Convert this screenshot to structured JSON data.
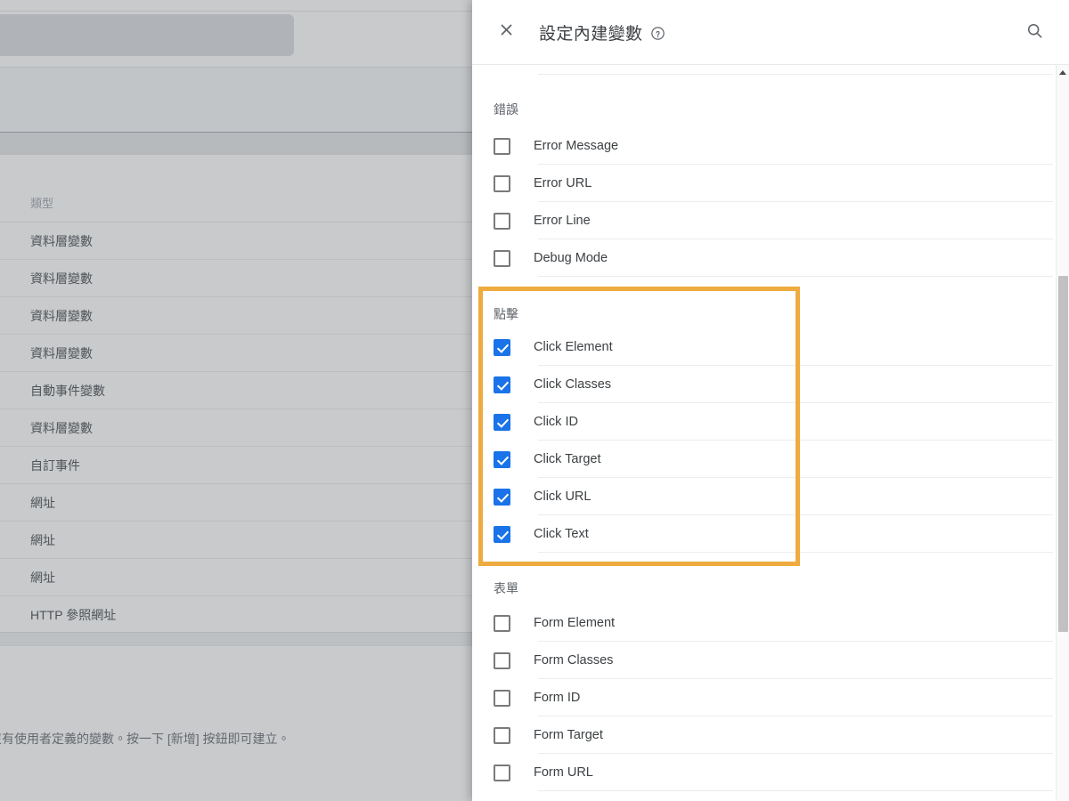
{
  "background": {
    "search_placeholder": "",
    "table": {
      "header": "類型",
      "rows": [
        "資料層變數",
        "資料層變數",
        "資料層變數",
        "資料層變數",
        "自動事件變數",
        "資料層變數",
        "自訂事件",
        "網址",
        "網址",
        "網址",
        "HTTP 參照網址"
      ]
    },
    "empty_note": "容器沒有使用者定義的變數。按一下 [新增] 按鈕即可建立。"
  },
  "panel": {
    "close_icon": "close-icon",
    "title": "設定內建變數",
    "help_icon": "help-circle-icon",
    "search_icon": "search-icon",
    "groups": [
      {
        "title": "錯誤",
        "items": [
          {
            "label": "Error Message",
            "checked": false
          },
          {
            "label": "Error URL",
            "checked": false
          },
          {
            "label": "Error Line",
            "checked": false
          },
          {
            "label": "Debug Mode",
            "checked": false
          }
        ]
      },
      {
        "title": "點擊",
        "highlighted": true,
        "items": [
          {
            "label": "Click Element",
            "checked": true
          },
          {
            "label": "Click Classes",
            "checked": true
          },
          {
            "label": "Click ID",
            "checked": true
          },
          {
            "label": "Click Target",
            "checked": true
          },
          {
            "label": "Click URL",
            "checked": true
          },
          {
            "label": "Click Text",
            "checked": true
          }
        ]
      },
      {
        "title": "表單",
        "items": [
          {
            "label": "Form Element",
            "checked": false
          },
          {
            "label": "Form Classes",
            "checked": false
          },
          {
            "label": "Form ID",
            "checked": false
          },
          {
            "label": "Form Target",
            "checked": false
          },
          {
            "label": "Form URL",
            "checked": false
          }
        ]
      }
    ],
    "scrollbar": {
      "arrow_up_icon": "triangle-up-icon"
    }
  },
  "colors": {
    "checkbox_checked": "#1a73e8",
    "annotation_highlight": "#eeab3f",
    "text_primary": "#3c4043",
    "text_secondary": "#5f6368"
  }
}
